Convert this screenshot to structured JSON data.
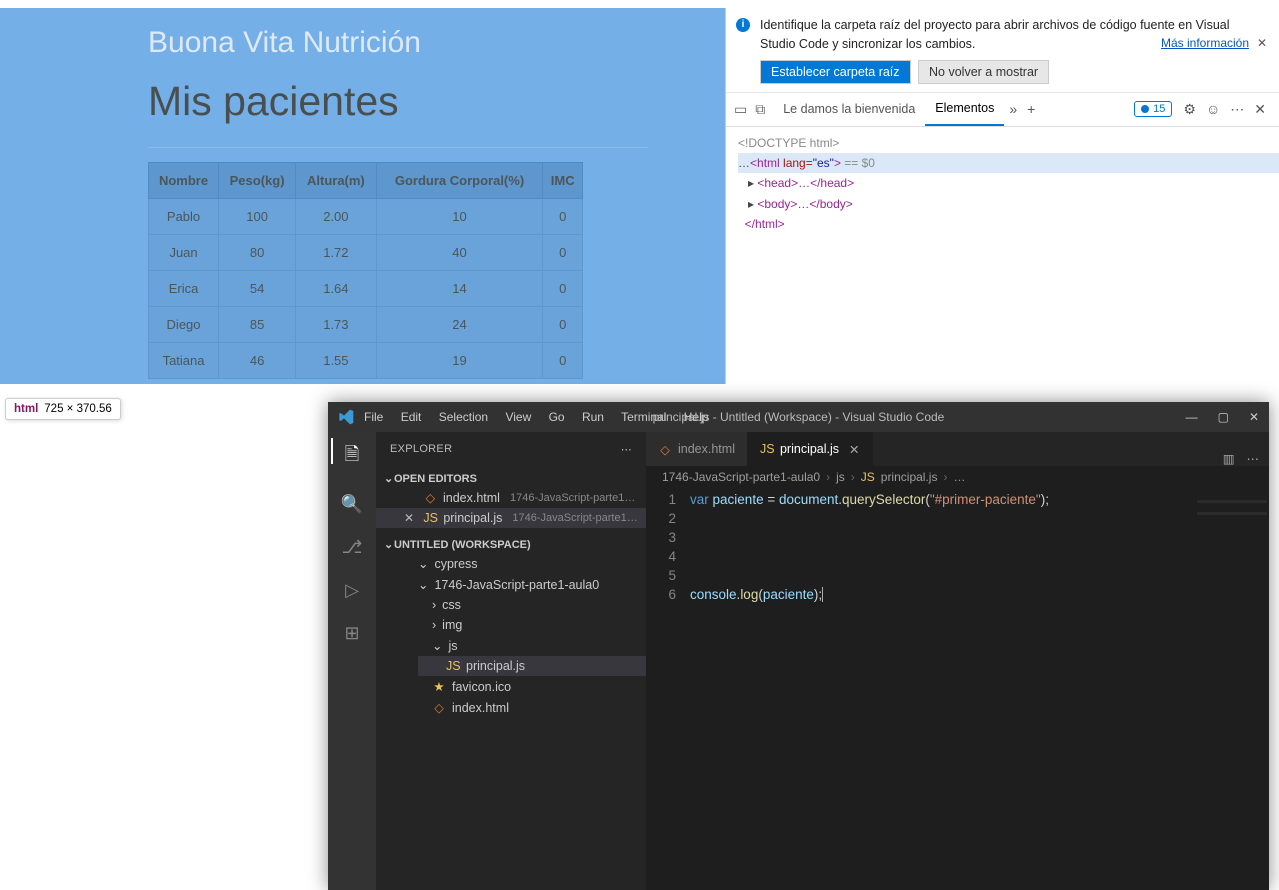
{
  "web": {
    "siteTitle": "Buona Vita Nutrición",
    "pageTitle": "Mis pacientes",
    "headers": [
      "Nombre",
      "Peso(kg)",
      "Altura(m)",
      "Gordura Corporal(%)",
      "IMC"
    ],
    "rows": [
      {
        "n": "Pablo",
        "p": "100",
        "a": "2.00",
        "g": "10",
        "i": "0"
      },
      {
        "n": "Juan",
        "p": "80",
        "a": "1.72",
        "g": "40",
        "i": "0"
      },
      {
        "n": "Erica",
        "p": "54",
        "a": "1.64",
        "g": "14",
        "i": "0"
      },
      {
        "n": "Diego",
        "p": "85",
        "a": "1.73",
        "g": "24",
        "i": "0"
      },
      {
        "n": "Tatiana",
        "p": "46",
        "a": "1.55",
        "g": "19",
        "i": "0"
      }
    ]
  },
  "tooltip": {
    "tag": "html",
    "dims": "725 × 370.56"
  },
  "devtools": {
    "banner": {
      "text": "Identifique la carpeta raíz del proyecto para abrir archivos de código fuente en Visual Studio Code y sincronizar los cambios.",
      "moreInfo": "Más información",
      "btnPrimary": "Establecer carpeta raíz",
      "btnSecondary": "No volver a mostrar"
    },
    "tabs": {
      "welcome": "Le damos la bienvenida",
      "elements": "Elementos",
      "issueCount": "15"
    },
    "dom": {
      "doctype": "<!DOCTYPE html>",
      "htmlOpen": "html",
      "langAttr": "lang=",
      "langVal": "\"es\"",
      "eqZero": " == $0",
      "head": "<head>…</head>",
      "body": "<body>…</body>",
      "htmlClose": "</html>"
    }
  },
  "vscode": {
    "menus": [
      "File",
      "Edit",
      "Selection",
      "View",
      "Go",
      "Run",
      "Terminal",
      "Help"
    ],
    "title": "principal.js - Untitled (Workspace) - Visual Studio Code",
    "explorer": {
      "header": "EXPLORER",
      "openEditors": "OPEN EDITORS",
      "workspace": "UNTITLED (WORKSPACE)",
      "indexHtml": "index.html",
      "indexHtmlPath": "1746-JavaScript-parte1-a...",
      "principalJs": "principal.js",
      "principalJsPath": "1746-JavaScript-parte1-a...",
      "folders": {
        "cypress": "cypress",
        "proj": "1746-JavaScript-parte1-aula0",
        "css": "css",
        "img": "img",
        "js": "js"
      },
      "files": {
        "principal": "principal.js",
        "favicon": "favicon.ico",
        "index": "index.html"
      }
    },
    "editor": {
      "tabIndex": "index.html",
      "tabPrincipal": "principal.js",
      "breadcrumb": [
        "1746-JavaScript-parte1-aula0",
        "js",
        "principal.js",
        "…"
      ],
      "code": {
        "l1": {
          "var": "var",
          "id": "paciente",
          "eq": " = ",
          "doc": "document",
          "dot": ".",
          "qs": "querySelector",
          "lp": "(",
          "str": "\"#primer-paciente\"",
          "rp": ");"
        },
        "l6": {
          "cons": "console",
          "dot": ".",
          "log": "log",
          "lp": "(",
          "id": "paciente",
          "rp": ");"
        }
      }
    }
  }
}
